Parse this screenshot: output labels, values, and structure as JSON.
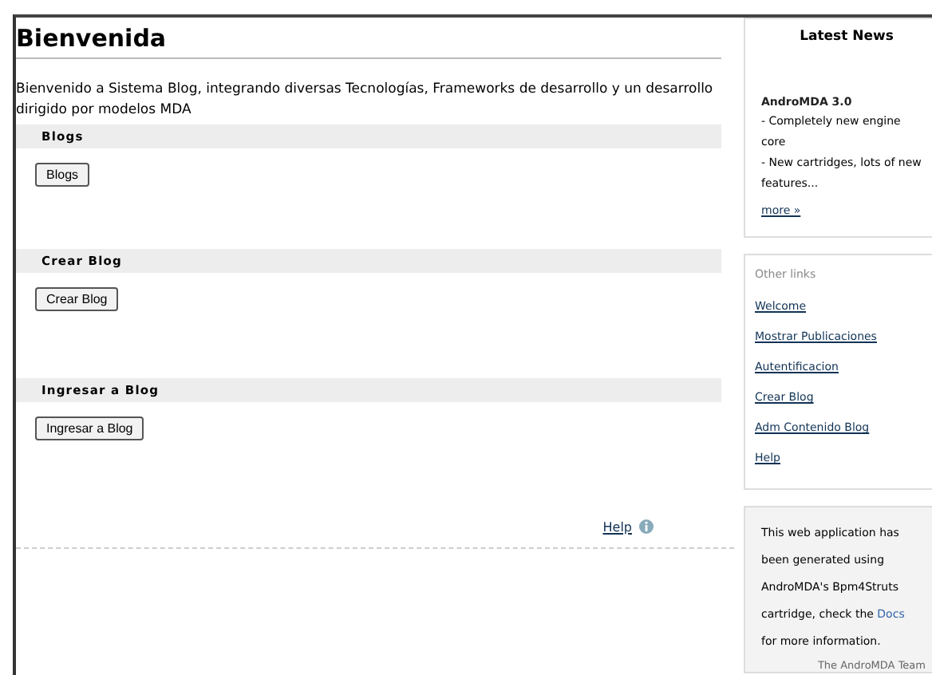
{
  "page": {
    "title": "Bienvenida",
    "intro": "Bienvenido a Sistema Blog, integrando diversas Tecnologías, Frameworks de desarrollo y un desarrollo dirigido por modelos MDA"
  },
  "sections": [
    {
      "heading": "Blogs",
      "button": "Blogs"
    },
    {
      "heading": "Crear Blog",
      "button": "Crear Blog"
    },
    {
      "heading": "Ingresar a Blog",
      "button": "Ingresar a Blog"
    }
  ],
  "help": {
    "label": "Help"
  },
  "latest_news": {
    "title": "Latest News",
    "item_title": "AndroMDA 3.0",
    "lines": [
      "- Completely new engine core",
      "- New cartridges, lots of new features..."
    ],
    "more": "more »"
  },
  "other_links": {
    "title": "Other links",
    "links": [
      "Welcome",
      "Mostrar Publicaciones",
      "Autentificacion",
      "Crear Blog",
      "Adm Contenido Blog",
      "Help"
    ]
  },
  "info": {
    "before": "This web application has been generated using AndroMDA's Bpm4Struts cartridge, check the",
    "link": "Docs",
    "after": "for more information.",
    "signature": "The AndroMDA Team"
  }
}
